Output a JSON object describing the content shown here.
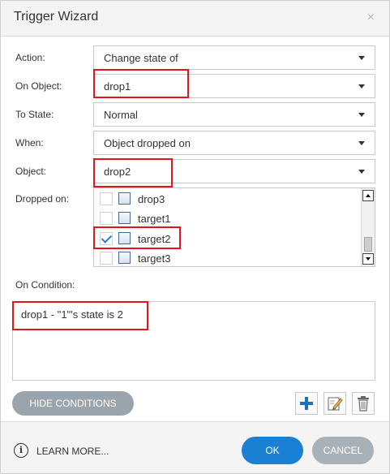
{
  "dialog": {
    "title": "Trigger Wizard",
    "close": "×"
  },
  "fields": {
    "action": {
      "label": "Action:",
      "value": "Change state of"
    },
    "on_object": {
      "label": "On Object:",
      "value": "drop1"
    },
    "to_state": {
      "label": "To State:",
      "value": "Normal"
    },
    "when": {
      "label": "When:",
      "value": "Object dropped on"
    },
    "object": {
      "label": "Object:",
      "value": "drop2"
    },
    "dropped_on": {
      "label": "Dropped on:",
      "items": [
        {
          "label": "drop3",
          "checked": false
        },
        {
          "label": "target1",
          "checked": false
        },
        {
          "label": "target2",
          "checked": true
        },
        {
          "label": "target3",
          "checked": false
        }
      ]
    }
  },
  "conditions": {
    "label": "On Condition:",
    "items": [
      "drop1 - \"1\"'s state is 2"
    ]
  },
  "buttons": {
    "hide_conditions": "HIDE CONDITIONS",
    "learn_more": "LEARN MORE...",
    "ok": "OK",
    "cancel": "CANCEL"
  },
  "icons": {
    "info": "i",
    "add": "plus-icon",
    "edit": "edit-icon",
    "delete": "trash-icon"
  },
  "colors": {
    "highlight": "#e4141b",
    "primary": "#1a80d4",
    "secondary": "#a9b1b8",
    "checkmark": "#2b7bd0"
  }
}
